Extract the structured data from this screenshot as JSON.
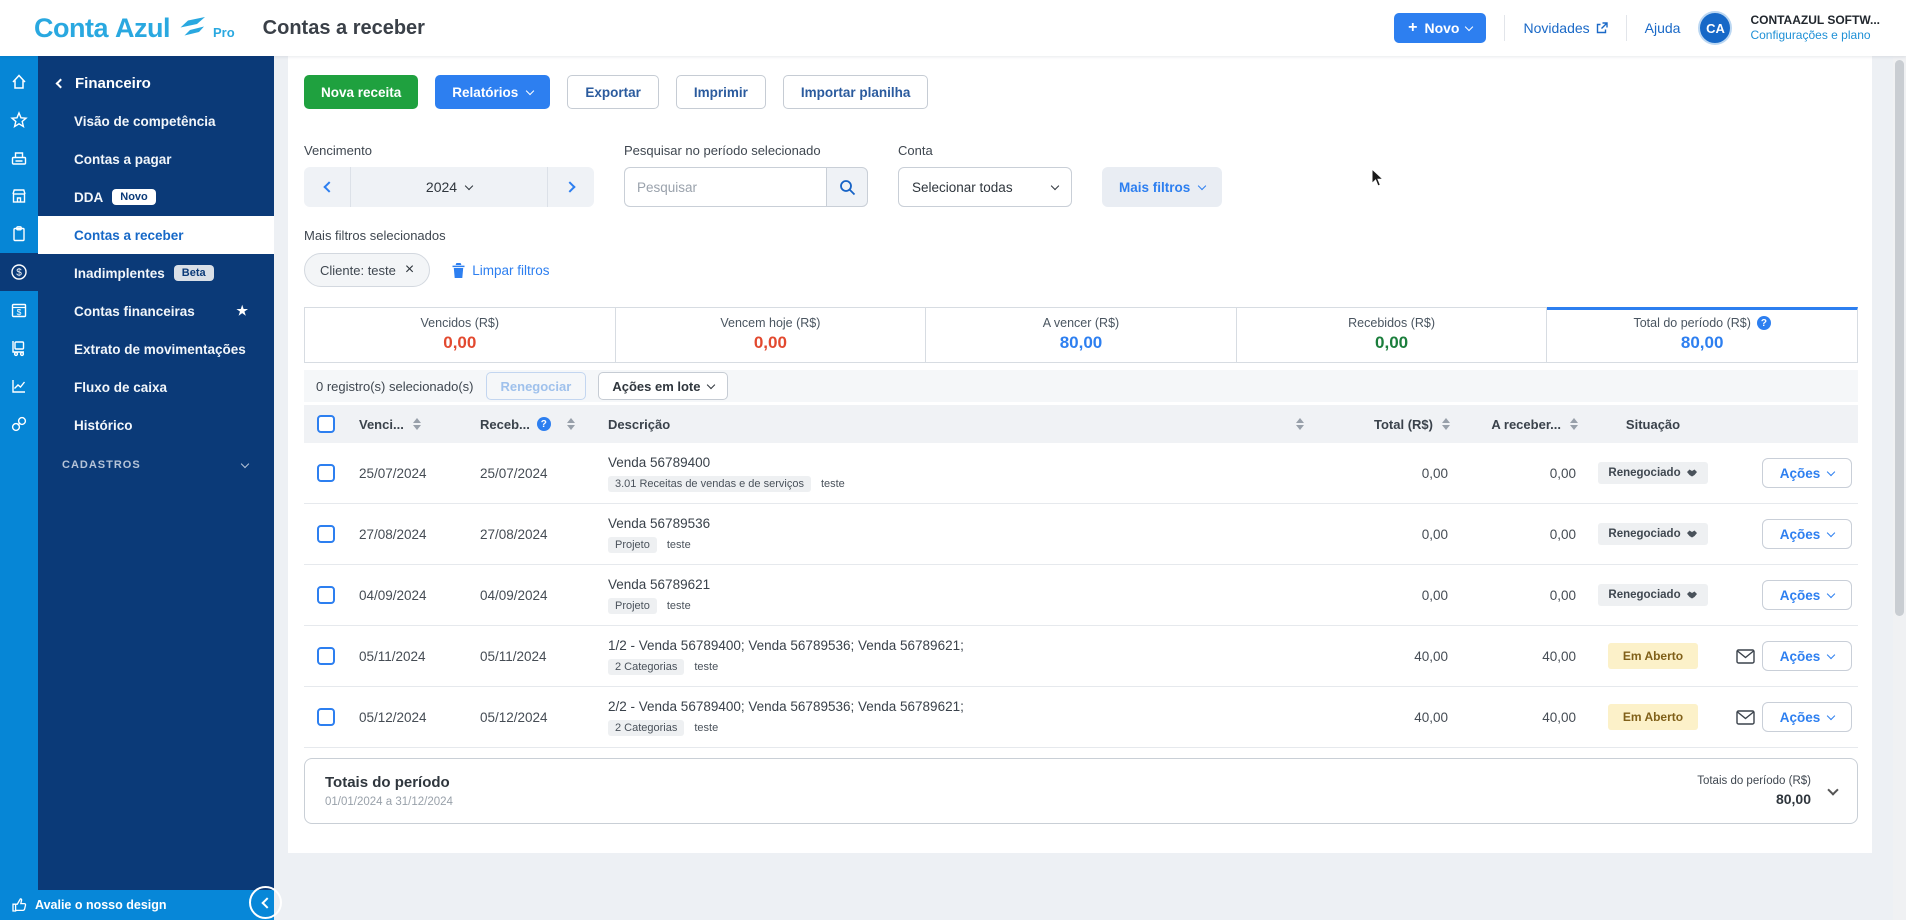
{
  "header": {
    "logo_conta": "Conta",
    "logo_azul": "Azul",
    "logo_pro": "Pro",
    "page_title": "Contas a receber",
    "novo_button": "Novo",
    "novidades_link": "Novidades",
    "ajuda_link": "Ajuda",
    "avatar_initials": "CA",
    "account_name": "CONTAAZUL SOFTW...",
    "account_settings": "Configurações e plano"
  },
  "sidebar": {
    "module_title": "Financeiro",
    "items": [
      {
        "label": "Visão de competência"
      },
      {
        "label": "Contas a pagar"
      },
      {
        "label": "DDA",
        "badge": "Novo"
      },
      {
        "label": "Contas a receber"
      },
      {
        "label": "Inadimplentes",
        "badge": "Beta"
      },
      {
        "label": "Contas financeiras"
      },
      {
        "label": "Extrato de movimentações"
      },
      {
        "label": "Fluxo de caixa"
      },
      {
        "label": "Histórico"
      }
    ],
    "section_cadastros": "CADASTROS",
    "feedback": "Avalie o nosso design"
  },
  "toolbar": {
    "nova_receita": "Nova receita",
    "relatorios": "Relatórios",
    "exportar": "Exportar",
    "imprimir": "Imprimir",
    "importar_planilha": "Importar planilha"
  },
  "filters": {
    "vencimento_label": "Vencimento",
    "year": "2024",
    "search_label": "Pesquisar no período selecionado",
    "search_placeholder": "Pesquisar",
    "conta_label": "Conta",
    "conta_value": "Selecionar todas",
    "mais_filtros": "Mais filtros",
    "selected_label": "Mais filtros selecionados",
    "chip": "Cliente: teste",
    "limpar": "Limpar filtros"
  },
  "summary_cards": [
    {
      "label": "Vencidos (R$)",
      "value": "0,00",
      "color": "#E2492F"
    },
    {
      "label": "Vencem hoje (R$)",
      "value": "0,00",
      "color": "#E2492F"
    },
    {
      "label": "A vencer (R$)",
      "value": "80,00",
      "color": "#2D7FF0"
    },
    {
      "label": "Recebidos (R$)",
      "value": "0,00",
      "color": "#1B7E3C"
    },
    {
      "label": "Total do período (R$)",
      "value": "80,00",
      "color": "#2D7FF0",
      "active": true,
      "has_help": true
    }
  ],
  "bulk": {
    "selected_text": "0 registro(s) selecionado(s)",
    "renegociar": "Renegociar",
    "acoes_lote": "Ações em lote"
  },
  "table": {
    "columns": {
      "venc": "Venci...",
      "receb": "Receb...",
      "desc": "Descrição",
      "total": "Total (R$)",
      "a_receber": "A receber...",
      "situacao": "Situação"
    },
    "rows": [
      {
        "venc": "25/07/2024",
        "receb": "25/07/2024",
        "desc": "Venda 56789400",
        "tag": "3.01 Receitas de vendas e de serviços",
        "tag2": "teste",
        "total": "0,00",
        "a_receber": "0,00",
        "situacao": "Renegociado",
        "acoes": "Ações"
      },
      {
        "venc": "27/08/2024",
        "receb": "27/08/2024",
        "desc": "Venda 56789536",
        "tag": "Projeto",
        "tag2": "teste",
        "total": "0,00",
        "a_receber": "0,00",
        "situacao": "Renegociado",
        "acoes": "Ações"
      },
      {
        "venc": "04/09/2024",
        "receb": "04/09/2024",
        "desc": "Venda 56789621",
        "tag": "Projeto",
        "tag2": "teste",
        "total": "0,00",
        "a_receber": "0,00",
        "situacao": "Renegociado",
        "acoes": "Ações"
      },
      {
        "venc": "05/11/2024",
        "receb": "05/11/2024",
        "desc": "1/2 - Venda 56789400; Venda 56789536; Venda 56789621;",
        "tag": "2 Categorias",
        "tag2": "teste",
        "total": "40,00",
        "a_receber": "40,00",
        "situacao": "Em Aberto",
        "acoes": "Ações"
      },
      {
        "venc": "05/12/2024",
        "receb": "05/12/2024",
        "desc": "2/2 - Venda 56789400; Venda 56789536; Venda 56789621;",
        "tag": "2 Categorias",
        "tag2": "teste",
        "total": "40,00",
        "a_receber": "40,00",
        "situacao": "Em Aberto",
        "acoes": "Ações"
      }
    ]
  },
  "totals_footer": {
    "title": "Totais do período",
    "period": "01/01/2024 a 31/12/2024",
    "total_label": "Totais do período (R$)",
    "total_value": "80,00"
  },
  "icons": {
    "plus": "+",
    "close": "×",
    "star": "★",
    "help": "?"
  },
  "colors": {
    "accent_blue": "#2D7FF0",
    "brand_blue": "#29A8E0",
    "sidebar_navy": "#0B3A78",
    "rail_blue": "#0686D6",
    "green": "#1FA13F",
    "red": "#E2492F",
    "value_green": "#1B7E3C",
    "yellow_badge_bg": "#FCF1C9"
  }
}
